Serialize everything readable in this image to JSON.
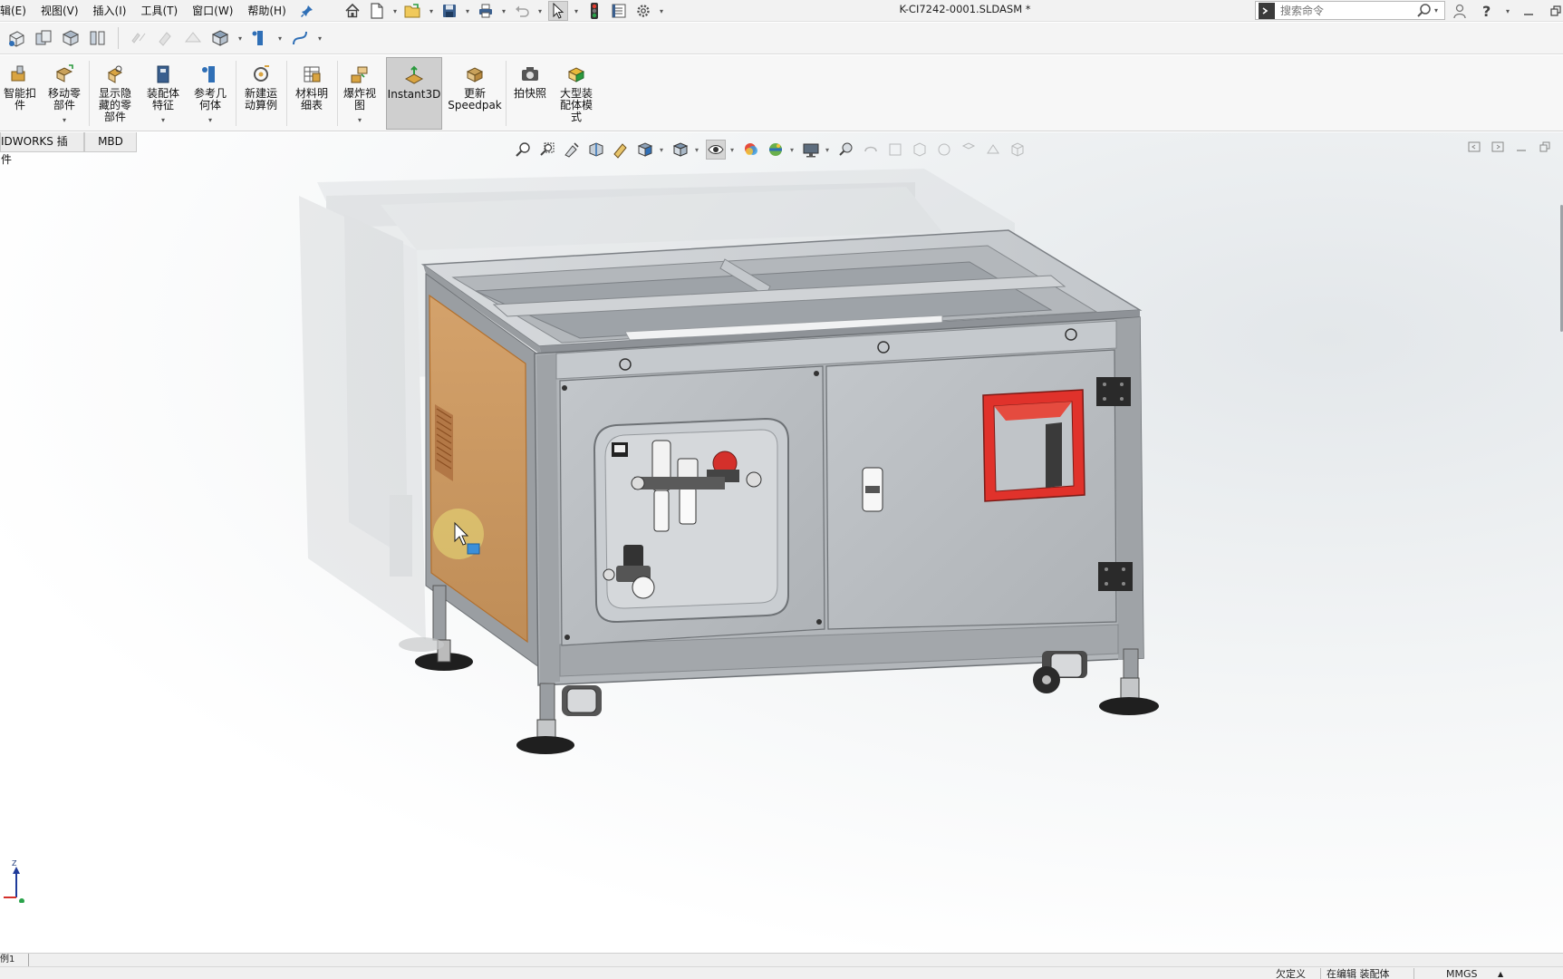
{
  "menu": {
    "items": [
      "辑(E)",
      "视图(V)",
      "插入(I)",
      "工具(T)",
      "窗口(W)",
      "帮助(H)"
    ]
  },
  "title": {
    "document": "K-CI7242-0001.SLDASM *"
  },
  "search": {
    "placeholder": "搜索命令"
  },
  "ribbon": {
    "buttons": [
      {
        "label": "智能扣\n件",
        "icon": "smart-fastener-icon"
      },
      {
        "label": "移动零\n部件",
        "icon": "move-component-icon"
      },
      {
        "label": "显示隐\n藏的零\n部件",
        "icon": "show-hidden-components-icon"
      },
      {
        "label": "装配体\n特征",
        "icon": "assembly-features-icon"
      },
      {
        "label": "参考几\n何体",
        "icon": "reference-geometry-icon"
      },
      {
        "label": "新建运\n动算例",
        "icon": "new-motion-study-icon"
      },
      {
        "label": "材料明\n细表",
        "icon": "bill-of-materials-icon"
      },
      {
        "label": "爆炸视\n图",
        "icon": "exploded-view-icon"
      },
      {
        "label": "Instant3D",
        "icon": "instant3d-icon"
      },
      {
        "label": "更新\nSpeedpak",
        "icon": "update-speedpak-icon"
      },
      {
        "label": "拍快照",
        "icon": "take-snapshot-icon"
      },
      {
        "label": "大型装\n配体模\n式",
        "icon": "large-assembly-mode-icon"
      }
    ]
  },
  "tabs": [
    "IDWORKS 插件",
    "MBD"
  ],
  "sheet": {
    "tab": "例1"
  },
  "status": {
    "definition": "欠定义",
    "editing": "在编辑 装配体",
    "units": "MMGS",
    "units_arrow": "▲"
  },
  "colors": {
    "accent_red": "#e0322b",
    "panel_orange": "#c9935a",
    "frame_gray": "#a9adb1",
    "panel_gray": "#b9bdc1"
  }
}
